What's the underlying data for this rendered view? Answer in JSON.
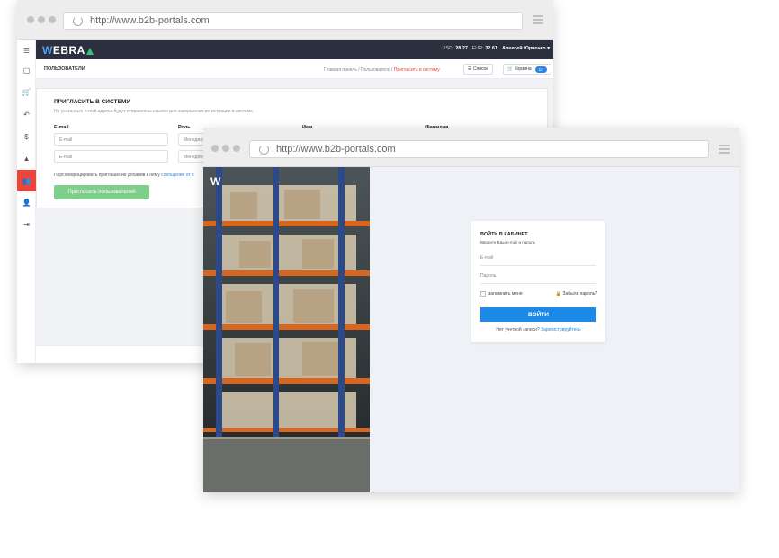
{
  "back_window": {
    "url": "http://www.b2b-portals.com",
    "logo_text": "EBRA",
    "logo_w": "W",
    "rates": {
      "usd_label": "USD:",
      "usd": "28.27",
      "eur_label": "EUR:",
      "eur": "32.61"
    },
    "user_name": "Алексей Юрченко",
    "page_title": "Пользователи",
    "breadcrumbs": [
      "Главная панель",
      "Пользователи",
      "Пригласить в систему"
    ],
    "list_btn": "Список",
    "cart_btn": "Корзина",
    "cart_count": "12",
    "card": {
      "heading": "Пригласить в систему",
      "sub": "На указанные e-mail адреса будут отправлены ссылки для завершения регистрации в системе.",
      "col_email": "E-mail",
      "col_role": "Роль",
      "col_name": "Имя",
      "col_surname": "Фамилия",
      "email_placeholder": "E-mail",
      "role_value": "Менеджер",
      "note_text": "Персонифицировать приглашение добавив к нему ",
      "note_link": "сообщение от с",
      "invite_btn": "Пригласить пользователей"
    }
  },
  "front_window": {
    "url": "http://www.b2b-portals.com",
    "photo_logo": "W",
    "login": {
      "title": "Войти в кабинет",
      "subtitle": "Введите Ваш e-mail и пароль",
      "email_placeholder": "E-mail",
      "password_placeholder": "Пароль",
      "remember": "запомнить меня",
      "forgot": "Забыли пароль?",
      "submit": "ВОЙТИ",
      "no_account": "Нет учетной записи? ",
      "register": "Зарегистрируйтесь"
    }
  },
  "icons": {
    "menu": "☰",
    "catalog": "▢",
    "cart": "🛒",
    "returns": "↶",
    "finance": "$",
    "education": "▲",
    "users": "👥",
    "user_add": "👤",
    "logout": "⇥",
    "lock": "🔒"
  },
  "colors": {
    "accent_red": "#f0443a",
    "nav_dark": "#2c2f3d",
    "login_blue": "#1e88e5",
    "invite_green": "#7fce8c"
  }
}
